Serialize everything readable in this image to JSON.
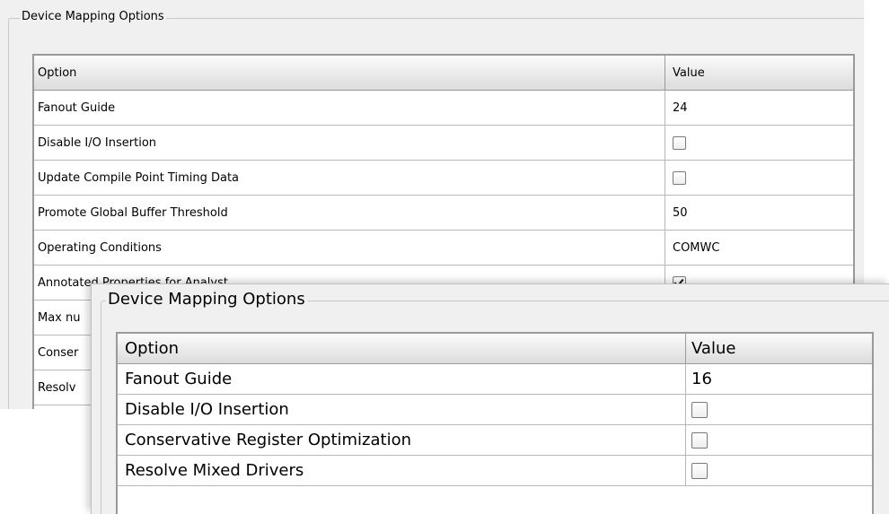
{
  "panel_back": {
    "group_title": "Device Mapping Options",
    "columns": {
      "option": "Option",
      "value": "Value"
    },
    "rows": [
      {
        "label": "Fanout Guide",
        "type": "text",
        "value": "24"
      },
      {
        "label": "Disable I/O Insertion",
        "type": "checkbox",
        "checked": false
      },
      {
        "label": "Update Compile Point Timing Data",
        "type": "checkbox",
        "checked": false
      },
      {
        "label": "Promote Global Buffer Threshold",
        "type": "text",
        "value": "50"
      },
      {
        "label": "Operating Conditions",
        "type": "text",
        "value": "COMWC"
      },
      {
        "label": "Annotated Properties for Analyst",
        "type": "checkbox",
        "checked": true
      },
      {
        "label": "Max nu",
        "type": "text",
        "value": ""
      },
      {
        "label": "Conser",
        "type": "text",
        "value": ""
      },
      {
        "label": "Resolv",
        "type": "text",
        "value": ""
      }
    ]
  },
  "panel_front": {
    "group_title": "Device Mapping Options",
    "columns": {
      "option": "Option",
      "value": "Value"
    },
    "rows": [
      {
        "label": "Fanout Guide",
        "type": "text",
        "value": "16"
      },
      {
        "label": "Disable I/O Insertion",
        "type": "checkbox",
        "checked": false
      },
      {
        "label": "Conservative Register Optimization",
        "type": "checkbox",
        "checked": false
      },
      {
        "label": "Resolve Mixed Drivers",
        "type": "checkbox",
        "checked": false
      }
    ]
  }
}
